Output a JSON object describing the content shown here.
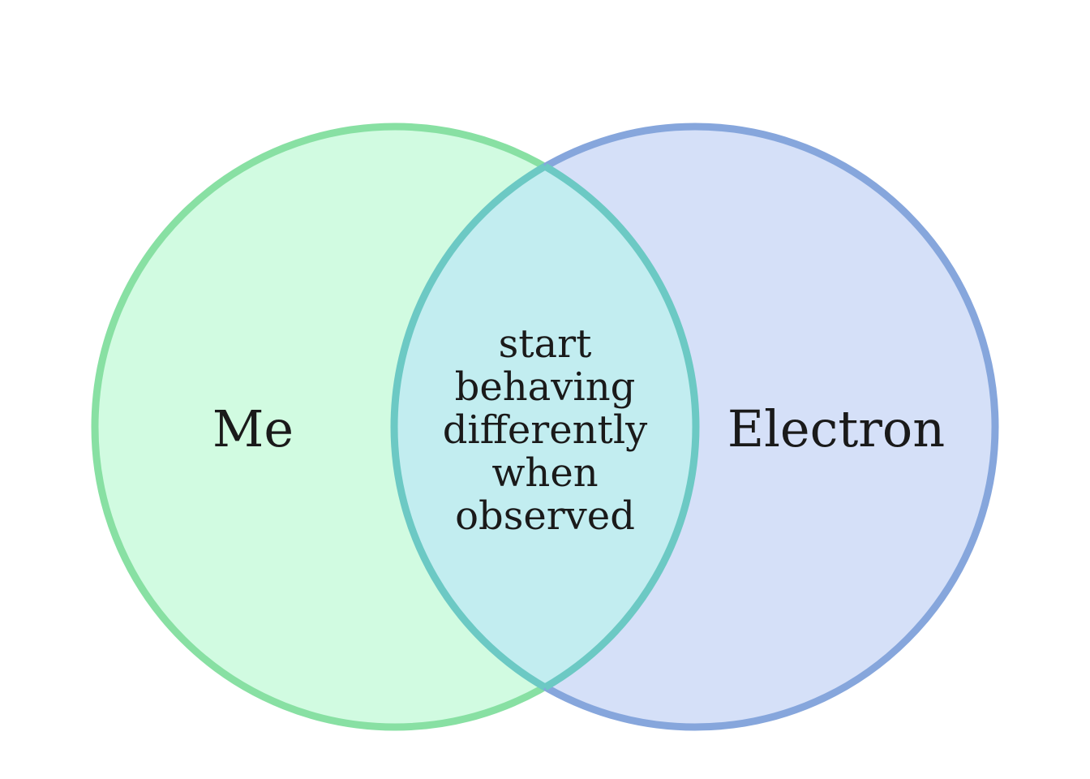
{
  "venn": {
    "sets": [
      {
        "label": "Me",
        "fill": "#d1fbe1",
        "stroke": "#88e0a3"
      },
      {
        "label": "Electron",
        "fill": "#d5e0f8",
        "stroke": "#86a6dc"
      }
    ],
    "intersection": {
      "lines": [
        "start",
        "behaving",
        "differently",
        "when",
        "observed"
      ],
      "fill": "#c2edf0",
      "stroke": "#6cc9c4"
    }
  }
}
